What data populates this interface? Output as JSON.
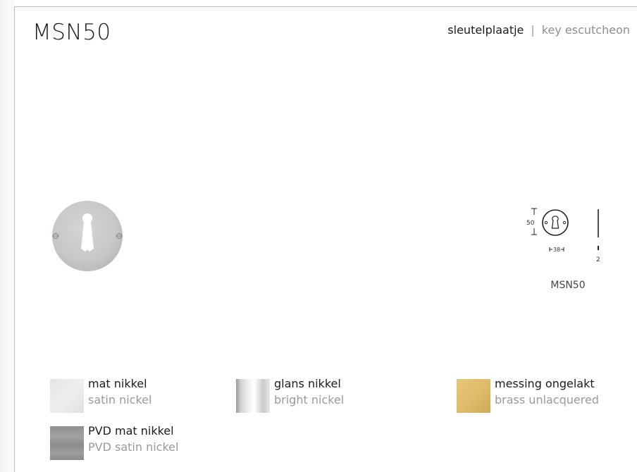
{
  "product": {
    "code": "MSN50",
    "type_nl": "sleutelplaatje",
    "separator": "|",
    "type_en": "key escutcheon"
  },
  "drawing": {
    "height_value": "50",
    "width_value": "38",
    "thickness_value": "2",
    "caption": "MSN50"
  },
  "finishes": [
    {
      "name_nl": "mat nikkel",
      "name_en": "satin nickel",
      "swatch": "satin-nickel",
      "color": "#e6e6e6"
    },
    {
      "name_nl": "glans nikkel",
      "name_en": "bright nickel",
      "swatch": "bright-nickel",
      "color": "#d8d8d8"
    },
    {
      "name_nl": "messing ongelakt",
      "name_en": "brass unlacquered",
      "swatch": "brass-unlacquered",
      "color": "#ddbc6c"
    },
    {
      "name_nl": "PVD mat nikkel",
      "name_en": "PVD satin nickel",
      "swatch": "pvd-satin-nickel",
      "color": "#969696"
    }
  ]
}
